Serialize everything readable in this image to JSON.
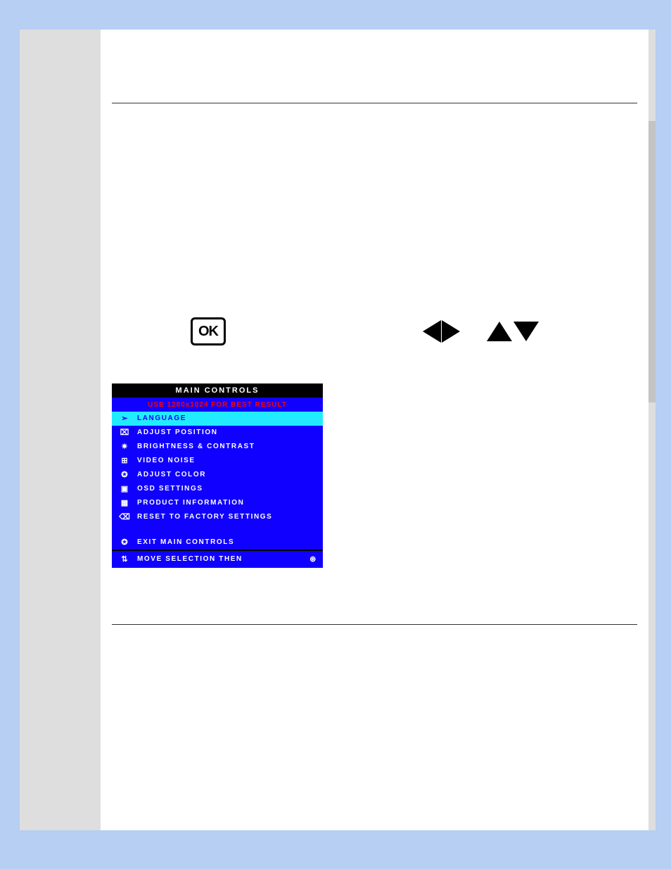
{
  "ok_label": "OK",
  "osd": {
    "title": "MAIN CONTROLS",
    "hint": "USE 1280x1024 FOR BEST RESULT",
    "items": [
      {
        "icon": "language-icon",
        "glyph": "➣",
        "label": "LANGUAGE",
        "selected": true
      },
      {
        "icon": "position-icon",
        "glyph": "⌧",
        "label": "ADJUST POSITION",
        "selected": false
      },
      {
        "icon": "brightness-icon",
        "glyph": "✷",
        "label": "BRIGHTNESS & CONTRAST",
        "selected": false
      },
      {
        "icon": "video-noise-icon",
        "glyph": "⊞",
        "label": "VIDEO NOISE",
        "selected": false
      },
      {
        "icon": "color-icon",
        "glyph": "✪",
        "label": "ADJUST COLOR",
        "selected": false
      },
      {
        "icon": "osd-settings-icon",
        "glyph": "▣",
        "label": "OSD SETTINGS",
        "selected": false
      },
      {
        "icon": "product-info-icon",
        "glyph": "▦",
        "label": "PRODUCT INFORMATION",
        "selected": false
      },
      {
        "icon": "reset-icon",
        "glyph": "⌫",
        "label": "RESET TO FACTORY SETTINGS",
        "selected": false
      }
    ],
    "exit": {
      "icon": "exit-icon",
      "glyph": "✪",
      "label": "EXIT MAIN CONTROLS"
    },
    "footer": {
      "nav_glyph": "⇅",
      "label": "MOVE SELECTION THEN",
      "ok_glyph": "⊛"
    }
  }
}
